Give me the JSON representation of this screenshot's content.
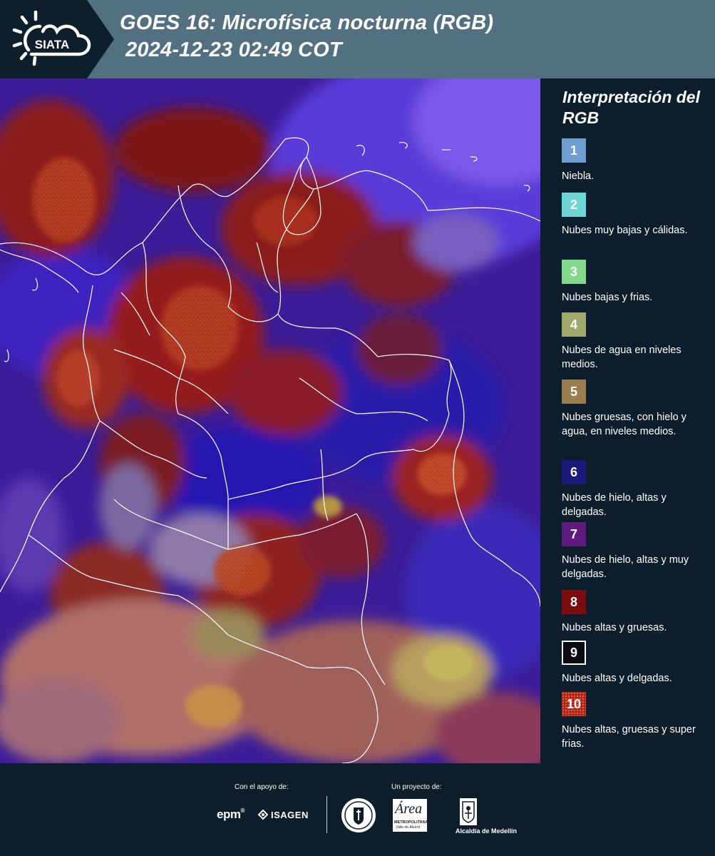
{
  "header": {
    "logo_text": "SIATA",
    "title_line1": "GOES 16: Microfísica nocturna (RGB)",
    "title_line2": "2024-12-23 02:49 COT"
  },
  "legend": {
    "title": "Interpretación del RGB",
    "items": [
      {
        "number": "1",
        "label": "Niebla.",
        "color": "#6f9fd0"
      },
      {
        "number": "2",
        "label": "Nubes muy bajas y cálidas.",
        "color": "#6fd6d6"
      },
      {
        "number": "3",
        "label": "Nubes bajas y frias.",
        "color": "#84d88d"
      },
      {
        "number": "4",
        "label": "Nubes de agua en niveles medios.",
        "color": "#a1a86c"
      },
      {
        "number": "5",
        "label": "Nubes gruesas, con hielo y agua, en niveles medios.",
        "color": "#9b7c4f"
      },
      {
        "number": "6",
        "label": "Nubes de hielo, altas y delgadas.",
        "color": "#1a1a7a"
      },
      {
        "number": "7",
        "label": "Nubes de hielo, altas y muy delgadas.",
        "color": "#5e1a7e"
      },
      {
        "number": "8",
        "label": "Nubes altas y gruesas.",
        "color": "#7a0e0e"
      },
      {
        "number": "9",
        "label": "Nubes altas y delgadas.",
        "color": "#0a0a14"
      },
      {
        "number": "10",
        "label": "Nubes altas, gruesas y super frias.",
        "color": "#b0281c"
      }
    ]
  },
  "footer": {
    "support_label": "Con el apoyo de:",
    "project_label": "Un proyecto de:",
    "epm": "epm",
    "isagen": "ISAGEN",
    "metropolitana_word": "Área",
    "metropolitana_sub": "METROPOLITANA",
    "metropolitana_sub2": "Valle de Aburrá",
    "alcaldia": "Alcaldía de Medellín"
  }
}
